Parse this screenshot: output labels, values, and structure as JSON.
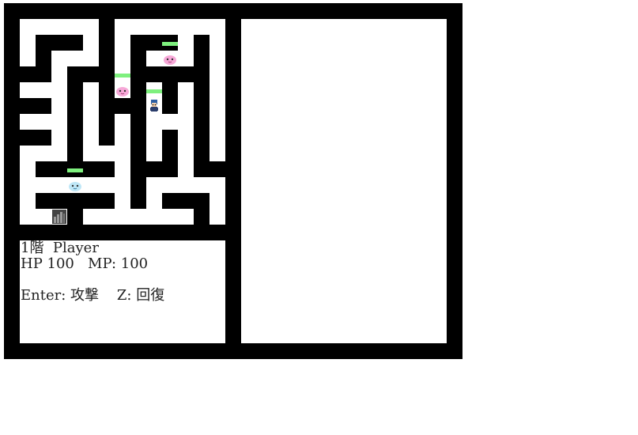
{
  "status": {
    "floor_player": "1階  Player",
    "stats": "HP 100   MP: 100",
    "controls": "Enter: 攻撃    Z: 回復"
  },
  "colors": {
    "wall": "#000000",
    "floor": "#ffffff",
    "hp_bar": "#7ef07e",
    "slime_pink": "#f7a8d8",
    "slime_blue": "#bfe7f7",
    "player_hair": "#2e5fa3"
  },
  "entities": [
    {
      "type": "slime-pink",
      "hp_bar": true
    },
    {
      "type": "slime-pink",
      "hp_bar": true
    },
    {
      "type": "player-hero",
      "hp_bar": true
    },
    {
      "type": "slime-blue",
      "hp_bar": true
    },
    {
      "type": "stairs-down",
      "hp_bar": false
    }
  ]
}
